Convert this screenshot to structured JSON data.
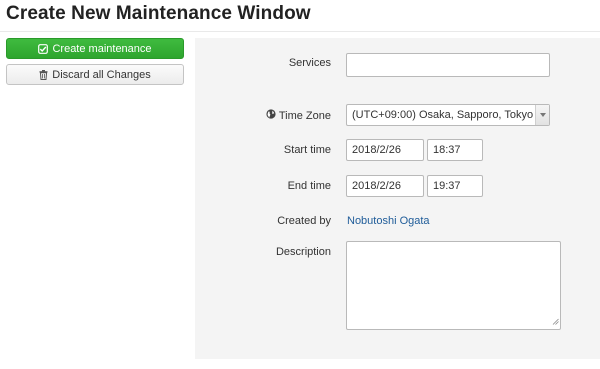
{
  "page": {
    "title": "Create New Maintenance Window"
  },
  "actions": {
    "create_label": "Create maintenance",
    "discard_label": "Discard all Changes"
  },
  "form": {
    "services": {
      "label": "Services",
      "value": ""
    },
    "time_zone": {
      "label": "Time Zone",
      "value": "(UTC+09:00) Osaka, Sapporo, Tokyo"
    },
    "start_time": {
      "label": "Start time",
      "date": "2018/2/26",
      "time": "18:37"
    },
    "end_time": {
      "label": "End time",
      "date": "2018/2/26",
      "time": "19:37"
    },
    "created_by": {
      "label": "Created by",
      "value": "Nobutoshi Ogata"
    },
    "description": {
      "label": "Description",
      "value": ""
    }
  },
  "icons": {
    "create": "check-square-icon",
    "discard": "trash-icon",
    "time_zone": "globe-icon",
    "select_arrow": "caret-down-icon",
    "textarea_resize": "resize-grip-icon"
  },
  "colors": {
    "primary_button": "#33aa33",
    "link": "#1f5c99",
    "panel_background": "#f4f4f4"
  }
}
